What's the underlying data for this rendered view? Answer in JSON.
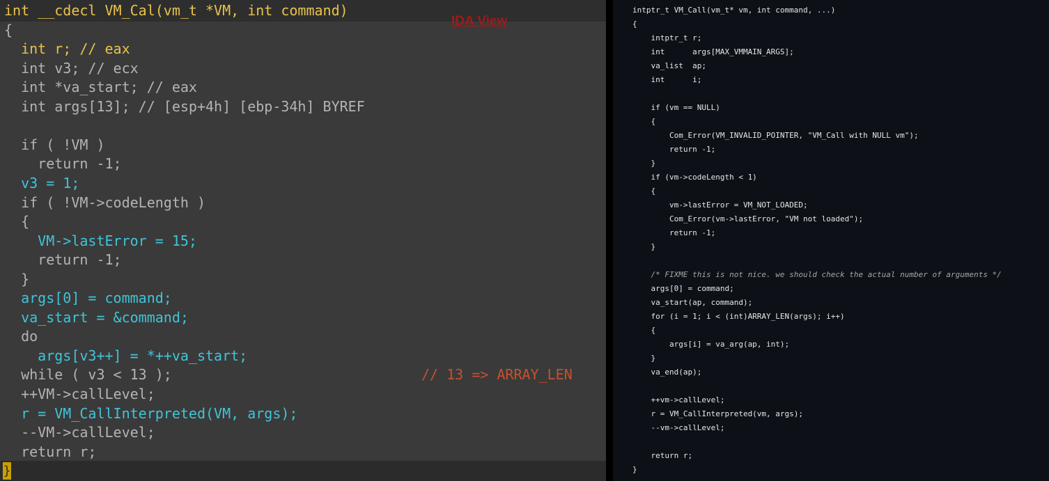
{
  "ida_view": {
    "tab_label": "IDA View",
    "comment_overlay": "// 13 => ARRAY_LEN",
    "lines": [
      "int __cdecl VM_Cal(vm_t *VM, int command)",
      "{",
      "  int r; // eax",
      "  int v3; // ecx",
      "  int *va_start; // eax",
      "  int args[13]; // [esp+4h] [ebp-34h] BYREF",
      "",
      "  if ( !VM )",
      "    return -1;",
      "  v3 = 1;",
      "  if ( !VM->codeLength )",
      "  {",
      "    VM->lastError = 15;",
      "    return -1;",
      "  }",
      "  args[0] = command;",
      "  va_start = &command;",
      "  do",
      "    args[v3++] = *++va_start;",
      "  while ( v3 < 13 );",
      "  ++VM->callLevel;",
      "  r = VM_CallInterpreted(VM, args);",
      "  --VM->callLevel;",
      "  return r;",
      "}"
    ]
  },
  "source_view": {
    "lines": [
      "intptr_t VM_Call(vm_t* vm, int command, ...)",
      "{",
      "    intptr_t r;",
      "    int      args[MAX_VMMAIN_ARGS];",
      "    va_list  ap;",
      "    int      i;",
      "",
      "    if (vm == NULL)",
      "    {",
      "        Com_Error(VM_INVALID_POINTER, \"VM_Call with NULL vm\");",
      "        return -1;",
      "    }",
      "    if (vm->codeLength < 1)",
      "    {",
      "        vm->lastError = VM_NOT_LOADED;",
      "        Com_Error(vm->lastError, \"VM not loaded\");",
      "        return -1;",
      "    }",
      "",
      "    /* FIXME this is not nice. we should check the actual number of arguments */",
      "    args[0] = command;",
      "    va_start(ap, command);",
      "    for (i = 1; i < (int)ARRAY_LEN(args); i++)",
      "    {",
      "        args[i] = va_arg(ap, int);",
      "    }",
      "    va_end(ap);",
      "",
      "    ++vm->callLevel;",
      "    r = VM_CallInterpreted(vm, args);",
      "    --vm->callLevel;",
      "",
      "    return r;",
      "}"
    ]
  },
  "colors": {
    "ida_background": "#3a3a3a",
    "ida_keyword_yellow": "#e9c24a",
    "ida_identifier_cyan": "#3fc5d9",
    "ida_comment_red": "#c8502e",
    "source_background": "#0d1117"
  }
}
